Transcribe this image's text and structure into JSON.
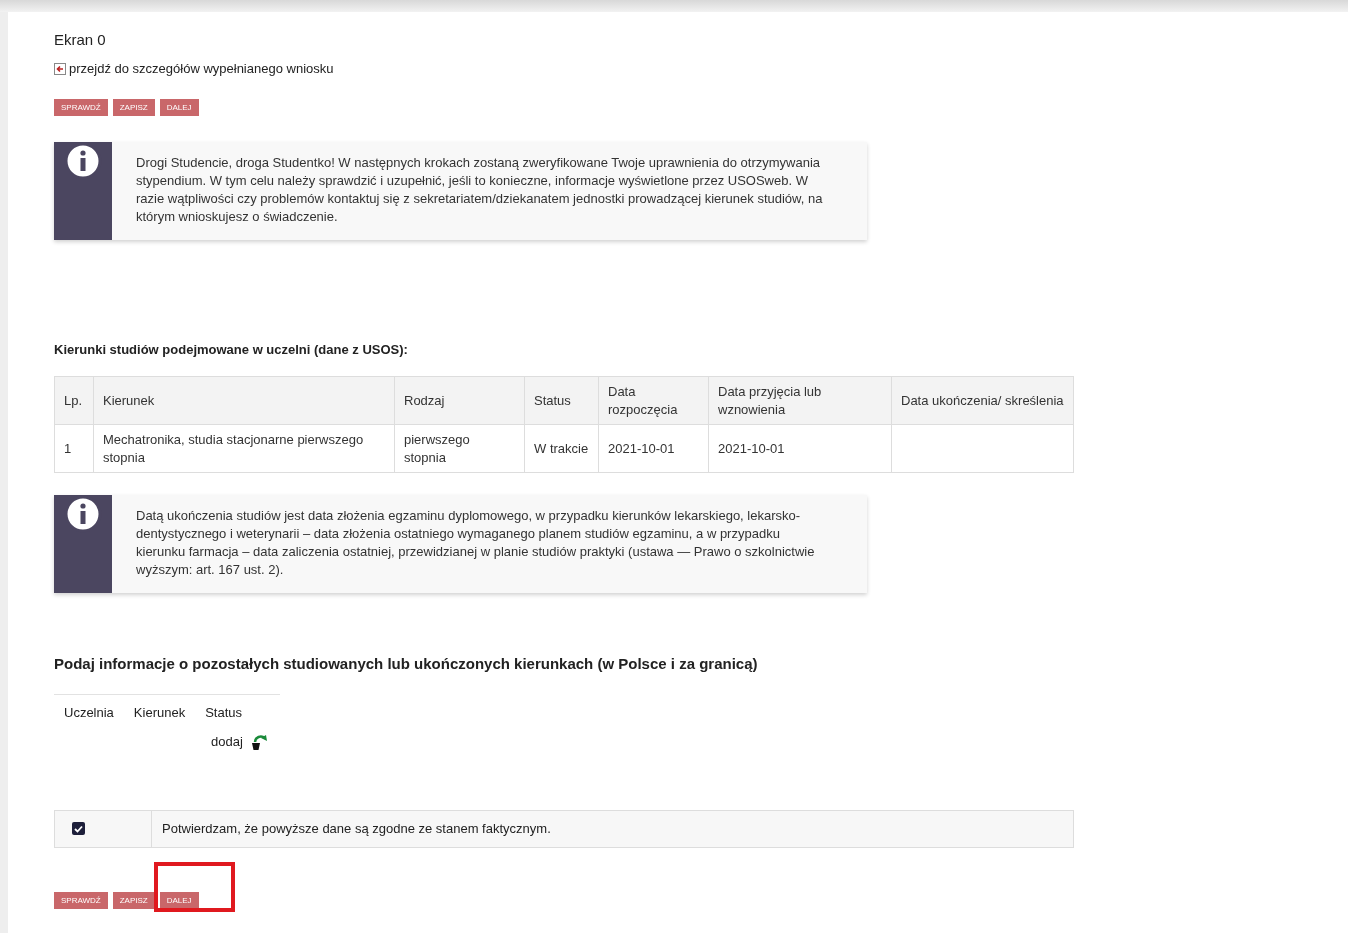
{
  "title": "Ekran 0",
  "back_link": "przejdź do szczegółów wypełnianego wniosku",
  "buttons_top": [
    "SPRAWDŹ",
    "ZAPISZ",
    "DALEJ"
  ],
  "notice_1": "Drogi Studencie, droga Studentko! W następnych krokach zostaną zweryfikowane Twoje uprawnienia do otrzymywania stypendium. W tym celu należy sprawdzić i uzupełnić, jeśli to konieczne, informacje wyświetlone przez USOSweb. W razie wątpliwości czy problemów kontaktuj się z sekretariatem/dziekanatem jednostki prowadzącej kierunek studiów, na którym wnioskujesz o świadczenie.",
  "studies_heading": "Kierunki studiów podejmowane w uczelni (dane z USOS):",
  "studies_table": {
    "columns": [
      "Lp.",
      "Kierunek",
      "Rodzaj",
      "Status",
      "Data rozpoczęcia",
      "Data przyjęcia lub wznowienia",
      "Data ukończenia/ skreślenia"
    ],
    "rows": [
      [
        "1",
        "Mechatronika, studia stacjonarne pierwszego stopnia",
        "pierwszego stopnia",
        "W trakcie",
        "2021-10-01",
        "2021-10-01",
        ""
      ]
    ]
  },
  "notice_2": "Datą ukończenia studiów jest data złożenia egzaminu dyplomowego, w przypadku kierunków lekarskiego, lekarsko-dentystycznego i weterynarii – data złożenia ostatniego wymaganego planem studiów egzaminu, a w przypadku kierunku farmacja – data zaliczenia ostatniej, przewidzianej w planie studiów praktyki (ustawa — Prawo o szkolnictwie wyższym: art. 167 ust. 2).",
  "other_heading": "Podaj informacje o pozostałych studiowanych lub ukończonych kierunkach (w Polsce i za granicą)",
  "other_table": {
    "columns": [
      "Uczelnia",
      "Kierunek",
      "Status"
    ],
    "add_label": "dodaj"
  },
  "confirmation": {
    "checked": true,
    "label": "Potwierdzam, że powyższe dane są zgodne ze stanem faktycznym."
  },
  "buttons_bottom": [
    {
      "label": "SPRAWDŹ",
      "highlighted": false
    },
    {
      "label": "ZAPISZ",
      "highlighted": false
    },
    {
      "label": "DALEJ",
      "highlighted": true
    }
  ]
}
